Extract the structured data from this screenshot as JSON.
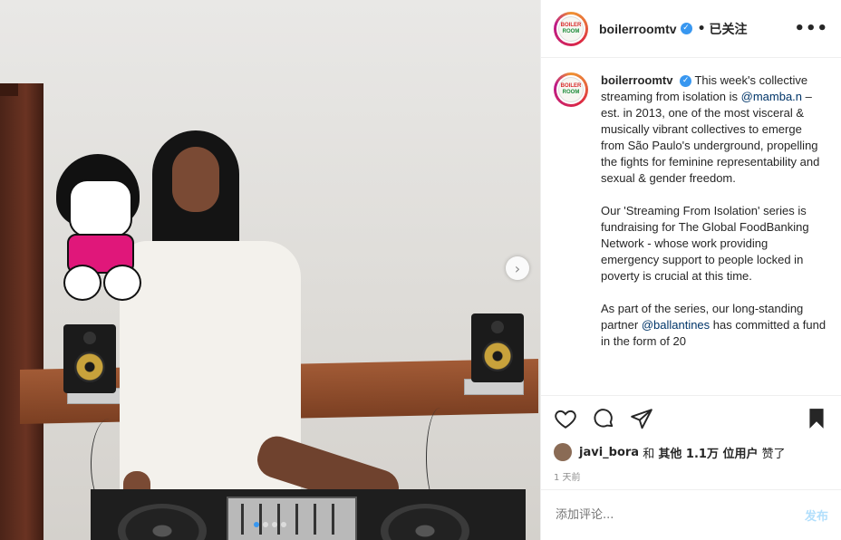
{
  "header": {
    "username": "boilerroomtv",
    "follow_status": "已关注",
    "separator": "•"
  },
  "caption": {
    "username": "boilerroomtv",
    "p1_text_a": "This week's collective streaming from isolation is ",
    "p1_mention": "@mamba.n",
    "p1_text_b": " – est. in 2013, one of the most visceral & musically vibrant collectives to emerge from São Paulo's underground, propelling the fights for feminine representability and sexual & gender freedom.",
    "p2": "Our 'Streaming From Isolation' series is fundraising for The Global FoodBanking Network - whose work providing emergency support to people locked in poverty is crucial at this time.",
    "p3_text_a": "As part of the series, our long-standing partner ",
    "p3_mention": "@ballantines",
    "p3_text_b": " has committed a fund in the form of 20"
  },
  "likes": {
    "user": "javi_bora",
    "text_and": "和",
    "others": "其他 1.1万 位用户",
    "text_liked": "赞了"
  },
  "timestamp": "1 天前",
  "comment": {
    "placeholder": "添加评论...",
    "post_label": "发布"
  },
  "icons": {
    "verified": "verified-badge-icon",
    "more": "more-options-icon",
    "like": "heart-icon",
    "comment": "comment-icon",
    "share": "share-icon",
    "save": "bookmark-icon",
    "next": "chevron-right-icon"
  },
  "carousel": {
    "slide_count": 4,
    "active_index": 0
  },
  "colors": {
    "verified": "#3897f0",
    "link": "#003569",
    "post_button": "#b2dffc"
  }
}
